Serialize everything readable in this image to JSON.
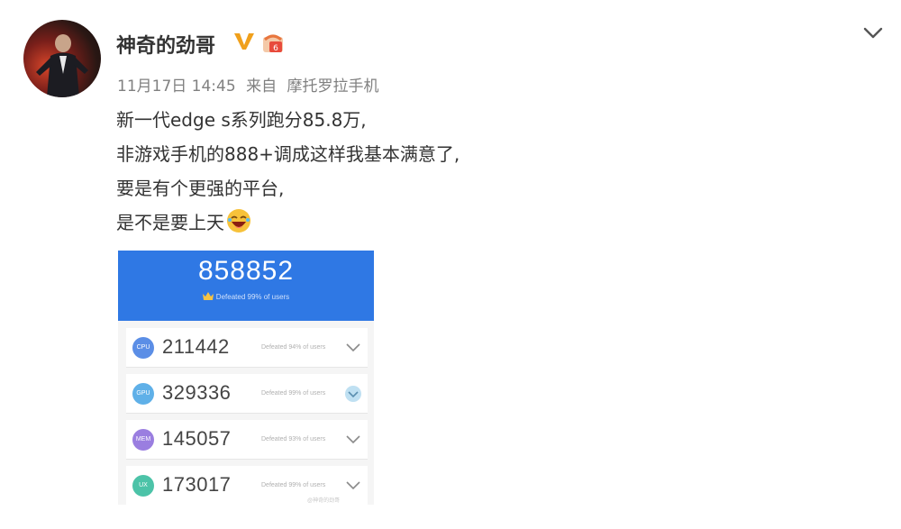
{
  "post": {
    "username": "神奇的劲哥",
    "verified_badge": "V",
    "timestamp": "11月17日 14:45",
    "source_prefix": "来自",
    "source": "摩托罗拉手机",
    "lines": [
      "新一代edge s系列跑分85.8万,",
      "非游戏手机的888+调成这样我基本满意了,",
      "要是有个更强的平台,",
      "是不是要上天"
    ],
    "emoji": "laughing-emoji",
    "collapse_icon": "chevron-down-icon"
  },
  "benchmark": {
    "total": "858852",
    "total_defeated": "Defeated 99% of users",
    "rows": [
      {
        "label": "CPU",
        "score": "211442",
        "defeated": "Defeated 94% of users",
        "color": "#5b8ee6"
      },
      {
        "label": "GPU",
        "score": "329336",
        "defeated": "Defeated 99% of users",
        "color": "#5fb0e8"
      },
      {
        "label": "MEM",
        "score": "145057",
        "defeated": "Defeated 93% of users",
        "color": "#9a7ee0"
      },
      {
        "label": "UX",
        "score": "173017",
        "defeated": "Defeated 99% of users",
        "color": "#4cc3a8"
      }
    ],
    "watermark": "@神奇的劲哥"
  },
  "colors": {
    "header_blue": "#2f78e4",
    "verified_orange": "#f0a01c",
    "text_main": "#333333",
    "text_meta": "#808080"
  }
}
